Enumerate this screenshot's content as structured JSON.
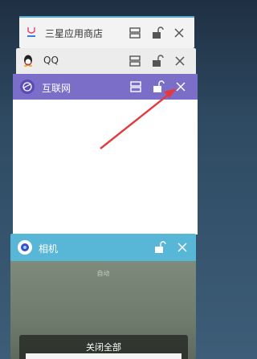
{
  "recents": [
    {
      "title": "三星应用商店",
      "icon": "galaxy-store-icon",
      "header_color": "#f3f3f3"
    },
    {
      "title": "QQ",
      "icon": "qq-penguin-icon",
      "header_color": "#ececec"
    },
    {
      "title": "互联网",
      "icon": "samsung-internet-icon",
      "header_color": "#7b6ec9",
      "accent": "#e43a3f"
    },
    {
      "title": "相机",
      "icon": "camera-icon",
      "header_color": "#58b6d6"
    }
  ],
  "camera_preview": {
    "label": "自动"
  },
  "close_all_label": "关闭全部",
  "annotation": {
    "arrow_color": "#e43a3f",
    "target": "close-icon"
  }
}
